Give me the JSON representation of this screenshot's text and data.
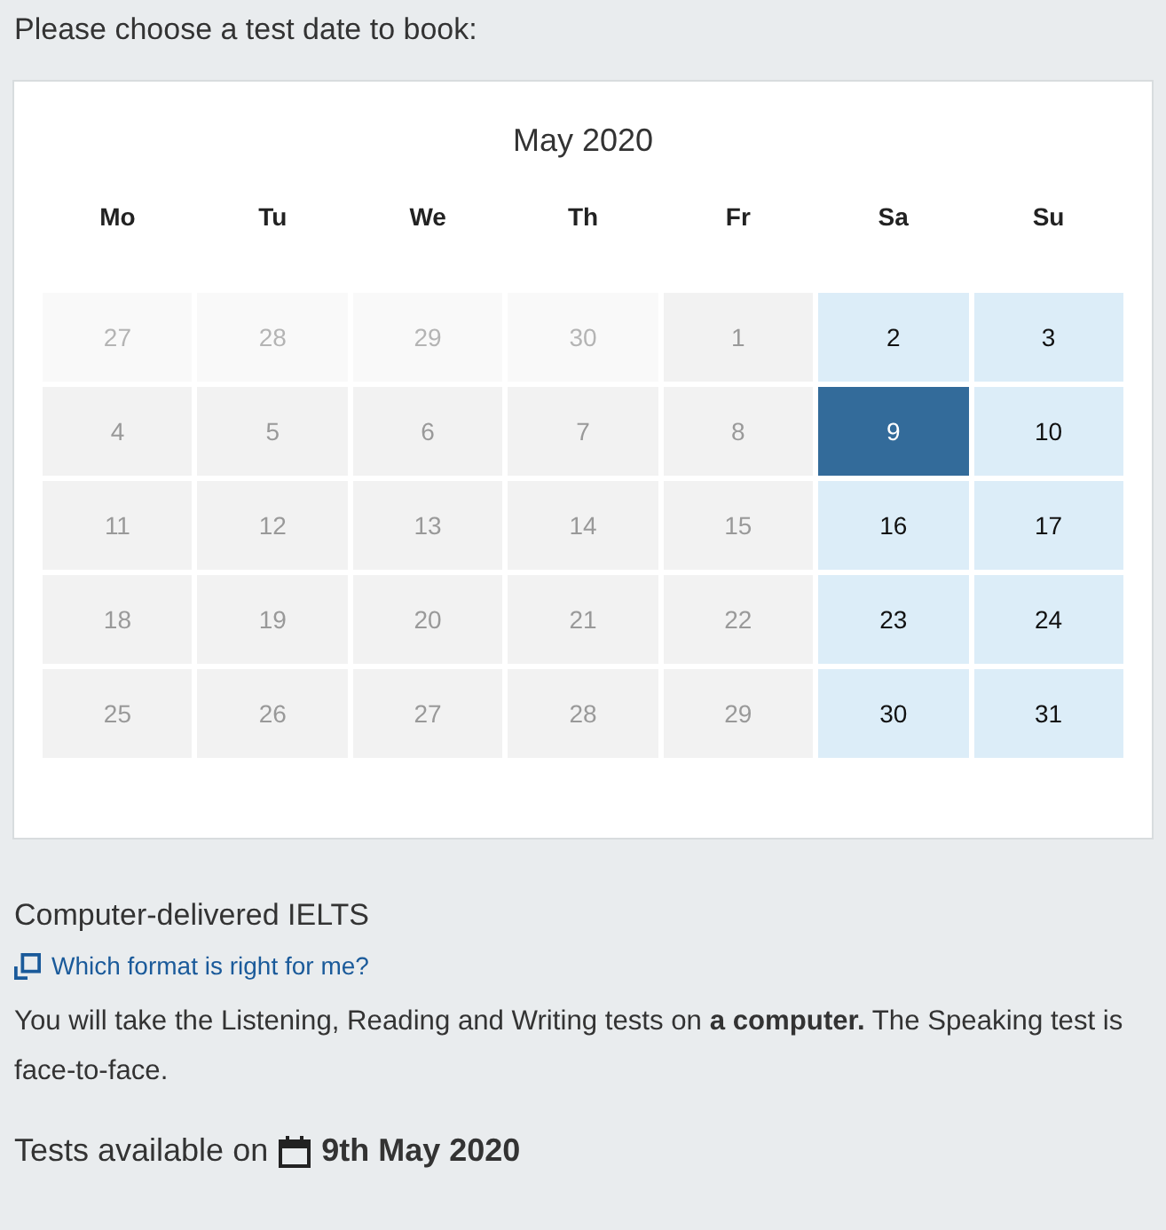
{
  "prompt": "Please choose a test date to book:",
  "calendar": {
    "month": "May 2020",
    "weekdays": [
      "Mo",
      "Tu",
      "We",
      "Th",
      "Fr",
      "Sa",
      "Su"
    ],
    "weeks": [
      [
        {
          "day": "27",
          "kind": "outside",
          "selected": false
        },
        {
          "day": "28",
          "kind": "outside",
          "selected": false
        },
        {
          "day": "29",
          "kind": "outside",
          "selected": false
        },
        {
          "day": "30",
          "kind": "outside",
          "selected": false
        },
        {
          "day": "1",
          "kind": "unavailable",
          "selected": false
        },
        {
          "day": "2",
          "kind": "available",
          "selected": false
        },
        {
          "day": "3",
          "kind": "available",
          "selected": false
        }
      ],
      [
        {
          "day": "4",
          "kind": "unavailable",
          "selected": false
        },
        {
          "day": "5",
          "kind": "unavailable",
          "selected": false
        },
        {
          "day": "6",
          "kind": "unavailable",
          "selected": false
        },
        {
          "day": "7",
          "kind": "unavailable",
          "selected": false
        },
        {
          "day": "8",
          "kind": "unavailable",
          "selected": false
        },
        {
          "day": "9",
          "kind": "available",
          "selected": true
        },
        {
          "day": "10",
          "kind": "available",
          "selected": false
        }
      ],
      [
        {
          "day": "11",
          "kind": "unavailable",
          "selected": false
        },
        {
          "day": "12",
          "kind": "unavailable",
          "selected": false
        },
        {
          "day": "13",
          "kind": "unavailable",
          "selected": false
        },
        {
          "day": "14",
          "kind": "unavailable",
          "selected": false
        },
        {
          "day": "15",
          "kind": "unavailable",
          "selected": false
        },
        {
          "day": "16",
          "kind": "available",
          "selected": false
        },
        {
          "day": "17",
          "kind": "available",
          "selected": false
        }
      ],
      [
        {
          "day": "18",
          "kind": "unavailable",
          "selected": false
        },
        {
          "day": "19",
          "kind": "unavailable",
          "selected": false
        },
        {
          "day": "20",
          "kind": "unavailable",
          "selected": false
        },
        {
          "day": "21",
          "kind": "unavailable",
          "selected": false
        },
        {
          "day": "22",
          "kind": "unavailable",
          "selected": false
        },
        {
          "day": "23",
          "kind": "available",
          "selected": false
        },
        {
          "day": "24",
          "kind": "available",
          "selected": false
        }
      ],
      [
        {
          "day": "25",
          "kind": "unavailable",
          "selected": false
        },
        {
          "day": "26",
          "kind": "unavailable",
          "selected": false
        },
        {
          "day": "27",
          "kind": "unavailable",
          "selected": false
        },
        {
          "day": "28",
          "kind": "unavailable",
          "selected": false
        },
        {
          "day": "29",
          "kind": "unavailable",
          "selected": false
        },
        {
          "day": "30",
          "kind": "available",
          "selected": false
        },
        {
          "day": "31",
          "kind": "available",
          "selected": false
        }
      ]
    ]
  },
  "format": {
    "title": "Computer-delivered IELTS",
    "link": "Which format is right for me?",
    "description": "You will take the Listening, Reading and Writing tests on **a computer.** The Speaking test is face-to-face."
  },
  "availability": {
    "label": "Tests available on",
    "date": "9th May 2020"
  }
}
